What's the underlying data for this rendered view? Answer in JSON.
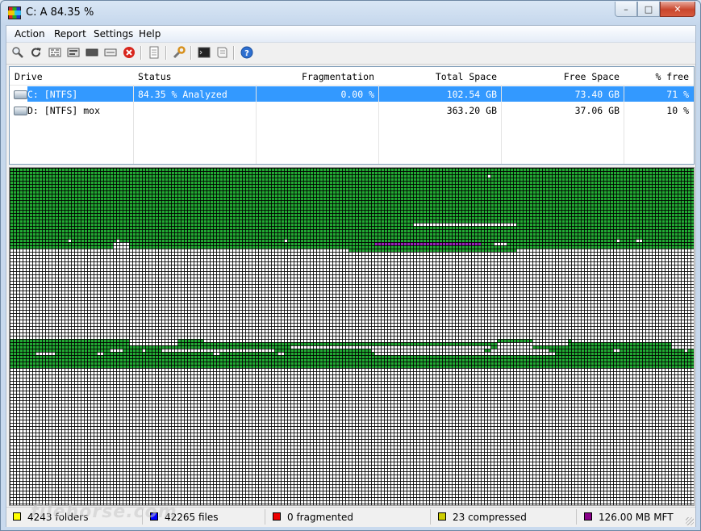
{
  "window": {
    "title": "C:  A  84.35 %",
    "buttons": {
      "minimize": "–",
      "maximize": "□",
      "close": "✕"
    }
  },
  "menu": {
    "items": [
      {
        "label": "Action"
      },
      {
        "label": "Report"
      },
      {
        "label": "Settings"
      },
      {
        "label": "Help"
      }
    ]
  },
  "toolbar": {
    "icons": [
      "analyze-icon",
      "repeat-icon",
      "defragment-icon",
      "quick-optimize-icon",
      "full-optimize-icon",
      "mft-optimize-icon",
      "stop-icon",
      "report-icon",
      "settings-icon",
      "boot-script-icon",
      "script-icon",
      "help-icon"
    ]
  },
  "drives": {
    "columns": [
      {
        "label": "Drive"
      },
      {
        "label": "Status"
      },
      {
        "label": "Fragmentation"
      },
      {
        "label": "Total Space"
      },
      {
        "label": "Free Space"
      },
      {
        "label": "% free"
      }
    ],
    "rows": [
      {
        "drive": "C: [NTFS]",
        "status": "84.35 % Analyzed",
        "fragmentation": "0.00 %",
        "total": "102.54 GB",
        "free": "73.40 GB",
        "percent_free": "71 %",
        "selected": true
      },
      {
        "drive": "D: [NTFS]  mox",
        "status": "",
        "fragmentation": "",
        "total": "363.20 GB",
        "free": "37.06 GB",
        "percent_free": "10 %",
        "selected": false
      }
    ]
  },
  "cluster_map": {
    "colors": {
      "free": "#ffffff",
      "used": "#22aa33",
      "mft": "#9922bb",
      "grid": "#000000"
    }
  },
  "status": {
    "folders": "4243 folders",
    "files": "42265 files",
    "fragmented": "0 fragmented",
    "compressed": "23 compressed",
    "mft": "126.00 MB MFT",
    "colors": {
      "folders": "#ffff00",
      "files": "#0000ff",
      "fragmented": "#ee0000",
      "compressed": "#cccc00",
      "mft": "#880088"
    }
  },
  "watermark": "filehorse.com"
}
